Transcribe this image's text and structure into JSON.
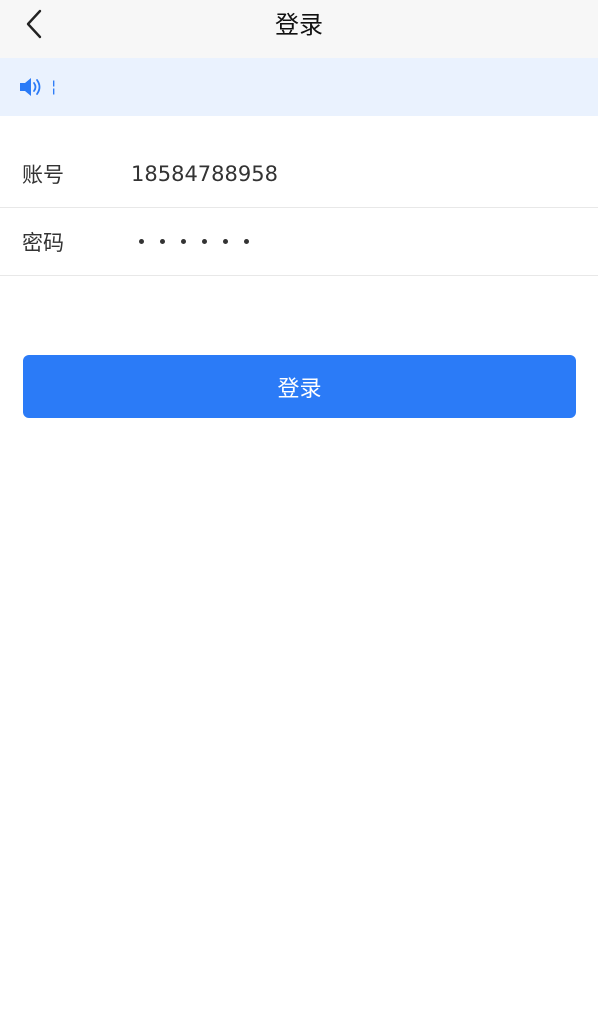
{
  "header": {
    "title": "登录",
    "back_icon": "chevron-left-icon"
  },
  "notice": {
    "icon": "speaker-icon",
    "text": "¦",
    "accent_color": "#2b7bf7",
    "background_color": "#eaf2fe"
  },
  "form": {
    "account": {
      "label": "账号",
      "value": "18584788958"
    },
    "password": {
      "label": "密码",
      "masked_length": 6
    }
  },
  "login_button": {
    "label": "登录",
    "color": "#2b7bf7"
  }
}
